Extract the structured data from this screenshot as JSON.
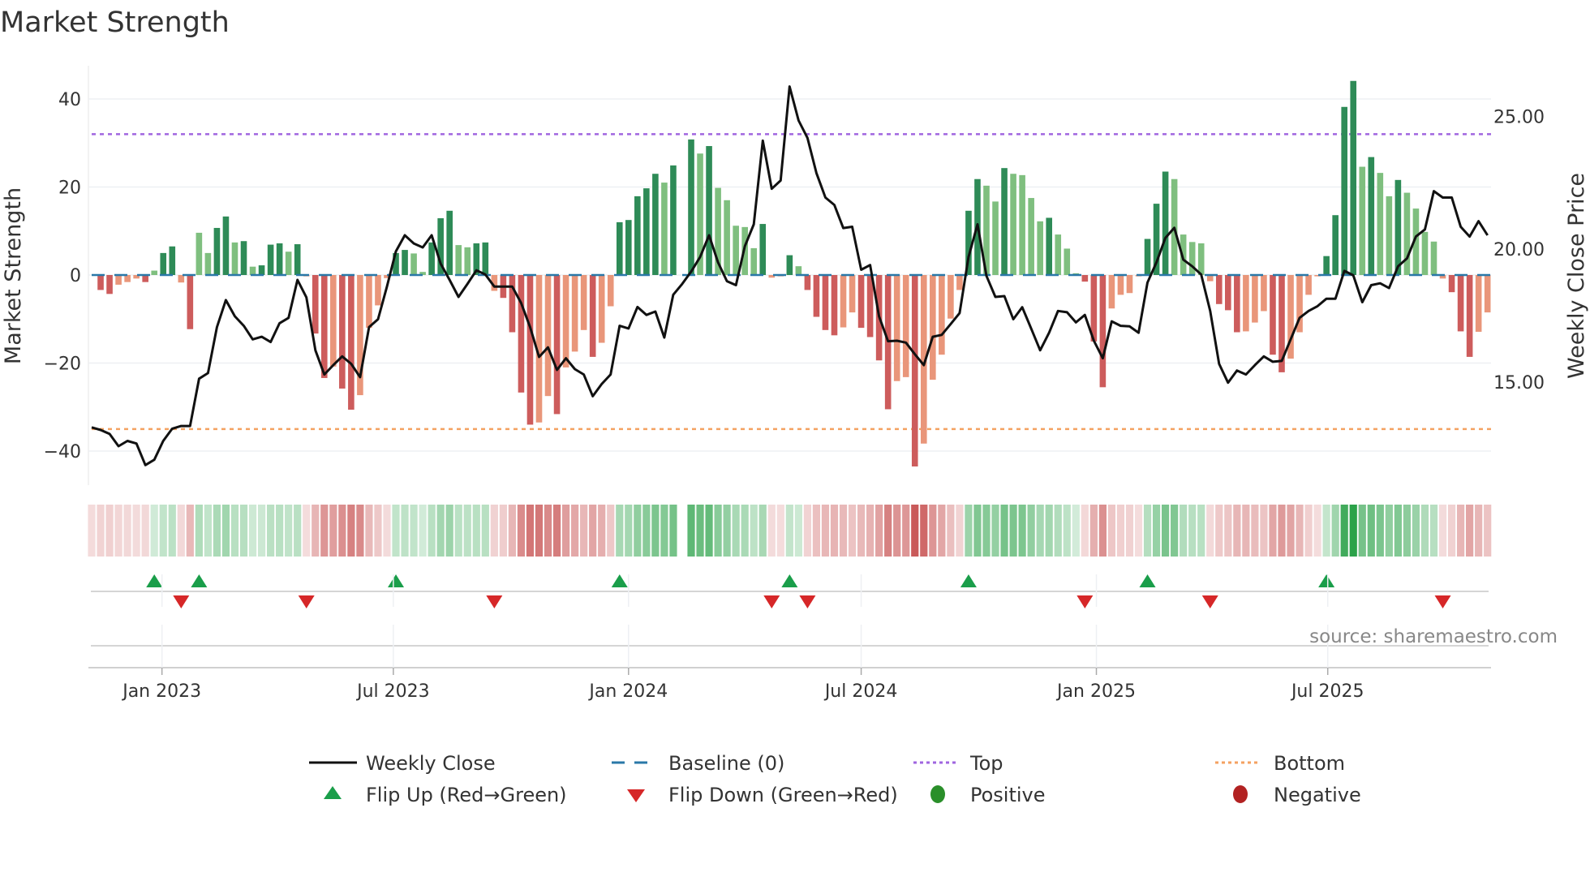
{
  "title": "Market Strength",
  "source": "source: sharemaestro.com",
  "colors": {
    "pos_strong": "#2e8b57",
    "pos_weak": "#7fbf7f",
    "neg_strong": "#cd5c5c",
    "neg_weak": "#e9967a",
    "baseline": "#2a78a8",
    "top": "#a066e0",
    "bottom": "#f4a261",
    "flip_up": "#1a9e4a",
    "flip_down": "#d62728",
    "positive": "#2a8f2a",
    "negative": "#b22222",
    "price": "#111111"
  },
  "chart_data": {
    "type": "bar+line",
    "title": "Market Strength",
    "ylabel": "Market Strength",
    "y2label": "Weekly Close Price",
    "ylim": [
      -48,
      48
    ],
    "y2lim": [
      11.7,
      26.8
    ],
    "yticks": [
      {
        "v": 40,
        "label": "40"
      },
      {
        "v": 20,
        "label": "20"
      },
      {
        "v": 0,
        "label": "0"
      },
      {
        "v": -20,
        "label": "−20"
      },
      {
        "v": -40,
        "label": "−40"
      }
    ],
    "y2ticks": [
      {
        "v": 25,
        "label": "25.00"
      },
      {
        "v": 20,
        "label": "20.00"
      },
      {
        "v": 15,
        "label": "15.00"
      }
    ],
    "x_start": "2022-11-07",
    "x_freq": "weekly",
    "xticks": [
      {
        "date": "2023-01-01",
        "label": "Jan 2023"
      },
      {
        "date": "2023-07-01",
        "label": "Jul 2023"
      },
      {
        "date": "2024-01-01",
        "label": "Jan 2024"
      },
      {
        "date": "2024-07-01",
        "label": "Jul 2024"
      },
      {
        "date": "2025-01-01",
        "label": "Jan 2025"
      },
      {
        "date": "2025-07-01",
        "label": "Jul 2025"
      }
    ],
    "top": 32,
    "bottom": -35,
    "baseline": 0,
    "strength": [
      -0.5,
      -3.4,
      -4.3,
      -2.2,
      -1.6,
      -0.8,
      -1.6,
      1.0,
      5.0,
      6.5,
      -1.7,
      -12.3,
      9.6,
      5.0,
      10.7,
      13.3,
      7.4,
      7.7,
      1.9,
      2.2,
      6.9,
      7.2,
      5.3,
      7.0,
      -0.3,
      -13.3,
      -23.4,
      -20.8,
      -25.8,
      -30.6,
      -27.3,
      -12,
      -6.9,
      -0.7,
      5.0,
      5.7,
      4.9,
      0.7,
      7.4,
      12.9,
      14.6,
      6.8,
      6.3,
      7.2,
      7.4,
      -3.6,
      -5.2,
      -13,
      -26.7,
      -34,
      -33.5,
      -27.5,
      -31.6,
      -21,
      -17.4,
      -12.5,
      -18.6,
      -15.4,
      -7.1,
      12.0,
      12.5,
      17.9,
      19.7,
      23.0,
      21.0,
      24.9,
      0,
      30.8,
      27.6,
      29.3,
      19.8,
      17.0,
      11.2,
      10.9,
      6.1,
      11.6,
      -0.6,
      -0.3,
      4.5,
      2.0,
      -3.4,
      -9.5,
      -12.5,
      -13.7,
      -11.9,
      -8.5,
      -12.0,
      -14.1,
      -19.4,
      -30.5,
      -24.1,
      -23.2,
      -43.5,
      -38.3,
      -23.8,
      -18.1,
      -9.9,
      -3.4,
      14.6,
      21.8,
      20.3,
      16.7,
      24.3,
      23.0,
      22.7,
      17.5,
      12.2,
      13.0,
      9.2,
      6.0,
      0.4,
      -1.5,
      -15.1,
      -25.5,
      -7.6,
      -4.5,
      -4.1,
      -0.3,
      8.2,
      16.2,
      23.5,
      21.8,
      9.2,
      7.5,
      7.2,
      -1.4,
      -6.6,
      -8.0,
      -13.0,
      -12.8,
      -10.8,
      -8.2,
      -18.1,
      -22.1,
      -19.0,
      -13.0,
      -4.5,
      -0.3,
      4.3,
      13.6,
      38.2,
      44.1,
      24.6,
      26.8,
      23.2,
      17.9,
      21.6,
      18.7,
      15.1,
      9.8,
      7.6,
      -0.8,
      -3.9,
      -12.8,
      -18.6,
      -12.9,
      -8.5
    ],
    "weekly_close": [
      13.29,
      13.19,
      13.04,
      12.58,
      12.78,
      12.68,
      11.87,
      12.07,
      12.78,
      13.24,
      13.34,
      13.34,
      15.12,
      15.33,
      17.06,
      18.08,
      17.47,
      17.11,
      16.6,
      16.7,
      16.5,
      17.21,
      17.41,
      18.84,
      18.18,
      16.19,
      15.28,
      15.63,
      15.96,
      15.68,
      15.18,
      17.06,
      17.36,
      18.59,
      19.91,
      20.52,
      20.21,
      20.06,
      20.52,
      19.45,
      18.84,
      18.2,
      18.69,
      19.2,
      19.04,
      18.59,
      18.59,
      18.59,
      17.97,
      17.06,
      15.94,
      16.3,
      15.45,
      15.89,
      15.48,
      15.28,
      14.46,
      14.92,
      15.28,
      17.11,
      17.01,
      17.82,
      17.52,
      17.65,
      16.67,
      18.28,
      18.69,
      19.15,
      19.7,
      20.52,
      19.5,
      18.79,
      18.64,
      20.11,
      20.93,
      24.08,
      22.27,
      22.58,
      26.12,
      24.84,
      24.18,
      22.86,
      21.94,
      21.66,
      20.79,
      20.84,
      19.22,
      19.4,
      17.47,
      16.53,
      16.55,
      16.48,
      16.04,
      15.63,
      16.7,
      16.77,
      17.18,
      17.59,
      19.7,
      20.93,
      18.99,
      18.2,
      18.23,
      17.36,
      17.81,
      17.01,
      16.19,
      16.85,
      17.67,
      17.62,
      17.24,
      17.52,
      16.55,
      15.89,
      17.28,
      17.11,
      17.09,
      16.85,
      18.74,
      19.5,
      20.42,
      20.8,
      19.6,
      19.35,
      19.04,
      17.67,
      15.68,
      14.97,
      15.43,
      15.28,
      15.63,
      15.96,
      15.76,
      15.79,
      16.6,
      17.41,
      17.67,
      17.85,
      18.13,
      18.13,
      19.18,
      19.01,
      18.0,
      18.64,
      18.71,
      18.53,
      19.35,
      19.65,
      20.47,
      20.74,
      22.18,
      21.94,
      21.94,
      20.84,
      20.47,
      21.05,
      20.52
    ],
    "flip_up_weeks": [
      7,
      12,
      34,
      59,
      78,
      98,
      118,
      138
    ],
    "flip_down_weeks": [
      10,
      24,
      45,
      76,
      80,
      111,
      125,
      151
    ],
    "legend": {
      "placement": "bottom",
      "items": [
        {
          "key": "weekly_close",
          "label": "Weekly Close"
        },
        {
          "key": "baseline",
          "label": "Baseline (0)"
        },
        {
          "key": "top",
          "label": "Top"
        },
        {
          "key": "bottom",
          "label": "Bottom"
        },
        {
          "key": "flip_up",
          "label": "Flip Up (Red→Green)"
        },
        {
          "key": "flip_down",
          "label": "Flip Down (Green→Red)"
        },
        {
          "key": "positive",
          "label": "Positive"
        },
        {
          "key": "negative",
          "label": "Negative"
        }
      ]
    }
  }
}
